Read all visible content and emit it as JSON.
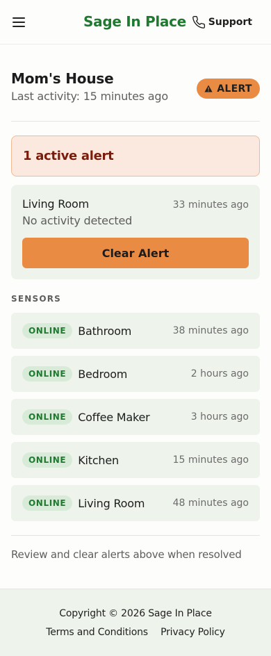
{
  "header": {
    "brand": "Sage In Place",
    "support_label": "Support"
  },
  "house": {
    "name": "Mom's House",
    "last_activity": "Last activity: 15 minutes ago",
    "status_badge": "ALERT"
  },
  "alert_summary": "1 active alert",
  "alerts": [
    {
      "room": "Living Room",
      "time": "33 minutes ago",
      "message": "No activity detected",
      "button_label": "Clear Alert"
    }
  ],
  "sensors_title": "SENSORS",
  "sensors": [
    {
      "status": "ONLINE",
      "name": "Bathroom",
      "time": "38 minutes ago"
    },
    {
      "status": "ONLINE",
      "name": "Bedroom",
      "time": "2 hours ago"
    },
    {
      "status": "ONLINE",
      "name": "Coffee Maker",
      "time": "3 hours ago"
    },
    {
      "status": "ONLINE",
      "name": "Kitchen",
      "time": "15 minutes ago"
    },
    {
      "status": "ONLINE",
      "name": "Living Room",
      "time": "48 minutes ago"
    }
  ],
  "hint": "Review and clear alerts above when resolved",
  "footer": {
    "copyright": "Copyright © 2026 Sage In Place",
    "terms": "Terms and Conditions",
    "privacy": "Privacy Policy"
  },
  "colors": {
    "brand_green": "#1e7a2e",
    "alert_orange": "#ea8b44",
    "card_bg": "#eef4ec",
    "alert_bg": "#fbe9df",
    "alert_text": "#7a1c0c"
  },
  "icons": {
    "menu": "menu-icon",
    "support": "phone-icon",
    "badge": "warning-icon"
  }
}
